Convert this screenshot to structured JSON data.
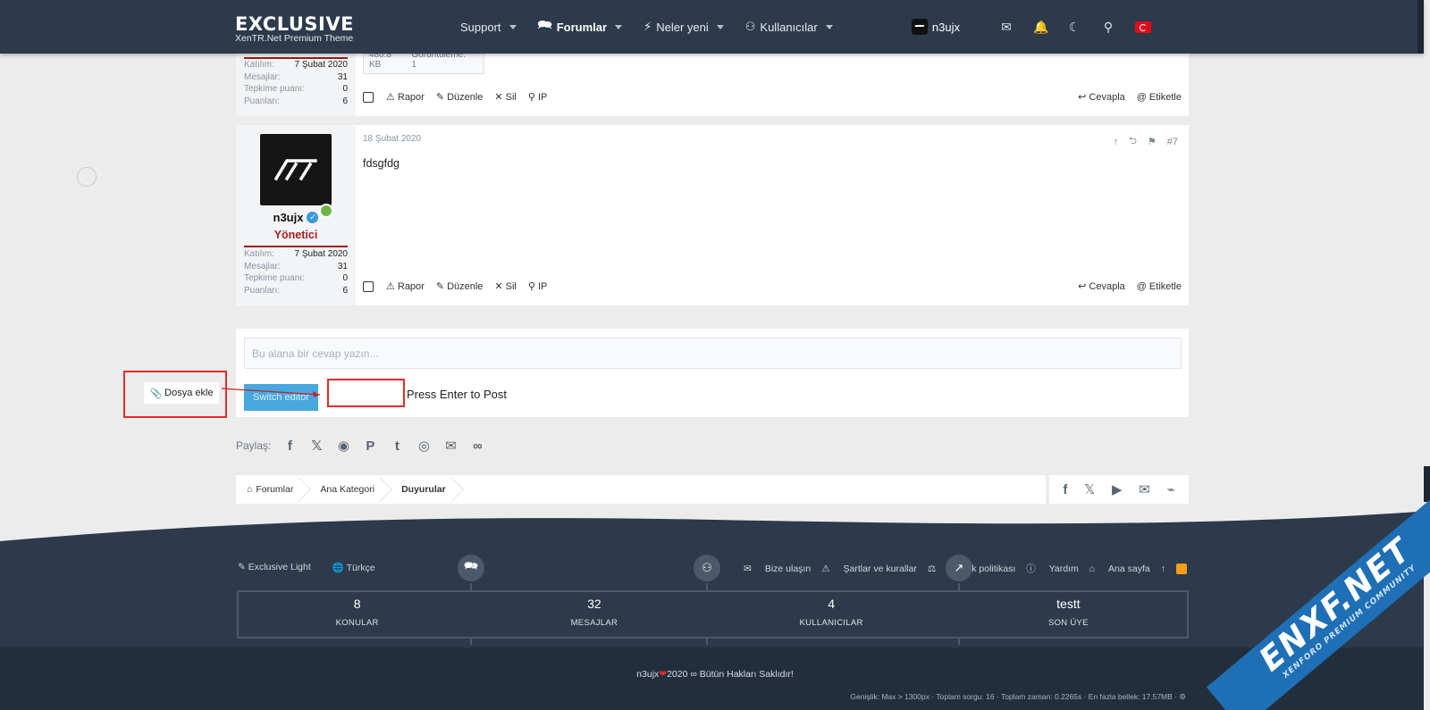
{
  "header": {
    "logo_title": "EXCLUSIVE",
    "logo_subtitle": "XenTR.Net Premium Theme",
    "nav": [
      {
        "label": "Support"
      },
      {
        "label": "Forumlar"
      },
      {
        "label": "Neler yeni"
      },
      {
        "label": "Kullanıcılar"
      }
    ],
    "username": "n3ujx"
  },
  "post_top": {
    "attachment_size": "480.8 KB",
    "attachment_views": "Görüntüleme: 1",
    "stats": [
      {
        "label": "Katılım:",
        "value": "7 Şubat 2020"
      },
      {
        "label": "Mesajlar:",
        "value": "31"
      },
      {
        "label": "Tepkime puanı:",
        "value": "0"
      },
      {
        "label": "Puanları:",
        "value": "6"
      }
    ]
  },
  "post": {
    "username": "n3ujx",
    "role": "Yönetici",
    "date": "18 Şubat 2020",
    "number": "#7",
    "body": "fdsgfdg",
    "stats": [
      {
        "label": "Katılım:",
        "value": "7 Şubat 2020"
      },
      {
        "label": "Mesajlar:",
        "value": "31"
      },
      {
        "label": "Tepkime puanı:",
        "value": "0"
      },
      {
        "label": "Puanları:",
        "value": "6"
      }
    ]
  },
  "actions": {
    "report": "Rapor",
    "edit": "Düzenle",
    "delete": "Sil",
    "ip": "IP",
    "reply": "Cevapla",
    "tag": "Etiketle"
  },
  "reply": {
    "placeholder": "Bu alana bir cevap yazın...",
    "switch_editor": "Switch editor",
    "attach": "Dosya ekle",
    "enter_hint": "Press Enter to Post"
  },
  "share_label": "Paylaş:",
  "breadcrumb": [
    "Forumlar",
    "Ana Kategori",
    "Duyurular"
  ],
  "footer": {
    "left": [
      "Exclusive Light",
      "Türkçe"
    ],
    "right": [
      "Bize ulaşın",
      "Şartlar ve kurallar",
      "Gizlilik politikası",
      "Yardım",
      "Ana sayfa"
    ],
    "stats": [
      {
        "value": "8",
        "label": "KONULAR"
      },
      {
        "value": "32",
        "label": "MESAJLAR"
      },
      {
        "value": "4",
        "label": "KULLANICILAR"
      },
      {
        "value": "testt",
        "label": "SON ÜYE"
      }
    ],
    "copyright_user": "n3ujx",
    "copyright_text": "2020 ∞ Bütün Hakları Saklıdır!",
    "debug": "Genişlik: Max > 1300px · Toplam sorgu: 16 · Toplam zaman: 0.2265s · En fazla bellek: 17.57MB ·"
  },
  "watermark": {
    "title": "ENXF.NET",
    "subtitle": "XENFORO PREMIUM COMMUNITY"
  },
  "colors": {
    "header": "#2c3a4b",
    "accent": "#47a8e0",
    "role": "#b11d1d",
    "highlight": "#e52b2b"
  }
}
